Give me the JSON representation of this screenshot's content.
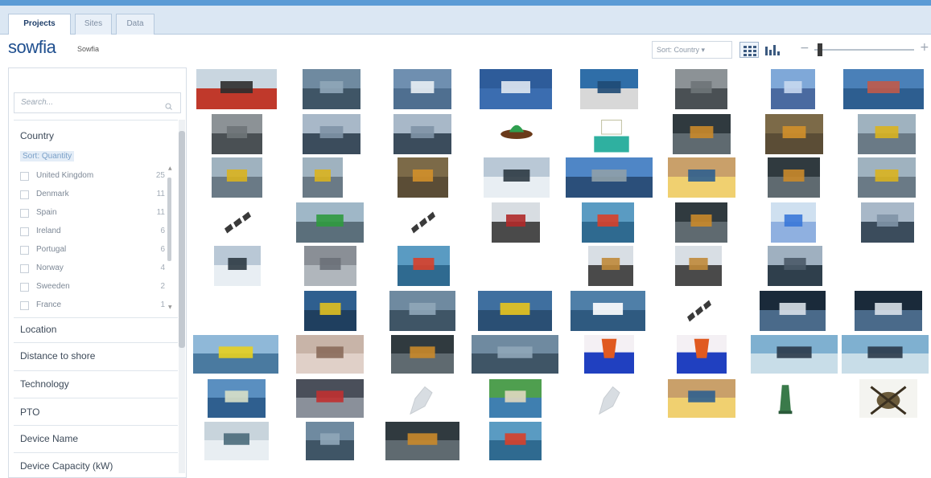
{
  "tabs": [
    {
      "label": "Projects",
      "active": true
    },
    {
      "label": "Sites",
      "active": false
    },
    {
      "label": "Data",
      "active": false
    }
  ],
  "header": {
    "logo": "sowfia",
    "app_name": "Sowfia",
    "sort_value": "Sort: Country ▾",
    "view_grid_icon": "grid-view-icon",
    "view_bars_icon": "bar-chart-view-icon",
    "zoom_minus": "−",
    "zoom_plus": "+"
  },
  "sidebar": {
    "search_placeholder": "Search...",
    "facet_country": "Country",
    "sort_quantity": "Sort: Quantity",
    "countries": [
      {
        "name": "United Kingdom",
        "count": "25"
      },
      {
        "name": "Denmark",
        "count": "11"
      },
      {
        "name": "Spain",
        "count": "11"
      },
      {
        "name": "Ireland",
        "count": "6"
      },
      {
        "name": "Portugal",
        "count": "6"
      },
      {
        "name": "Norway",
        "count": "4"
      },
      {
        "name": "Sweeden",
        "count": "2"
      },
      {
        "name": "France",
        "count": "1"
      }
    ],
    "facets": [
      "Location",
      "Distance to shore",
      "Technology",
      "PTO",
      "Device Name",
      "Device Capacity (kW)"
    ]
  },
  "grid": {
    "thumbnail_count": 62
  },
  "colors": {
    "accent": "#5b9bd5",
    "tab_bar": "#dbe7f3",
    "logo": "#1f4f8f"
  }
}
